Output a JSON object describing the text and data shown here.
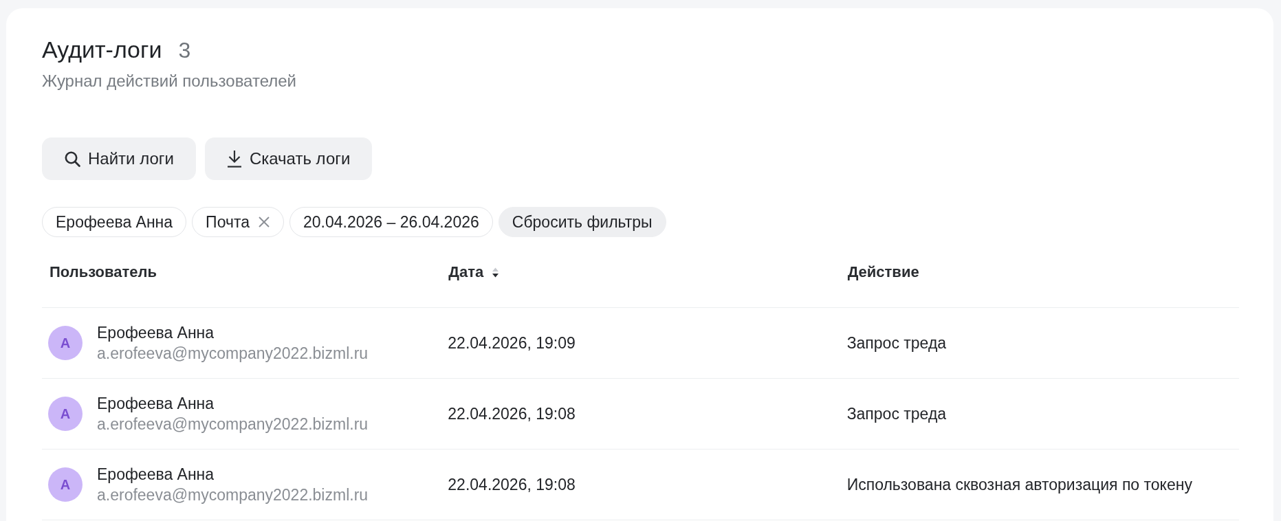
{
  "header": {
    "title": "Аудит-логи",
    "count": "3",
    "subtitle": "Журнал действий пользователей"
  },
  "actions": [
    {
      "kind": "search",
      "label": "Найти логи"
    },
    {
      "kind": "download",
      "label": "Скачать логи"
    }
  ],
  "filters": {
    "chips": [
      {
        "label": "Ерофеева Анна",
        "removable": false
      },
      {
        "label": "Почта",
        "removable": true
      },
      {
        "label": "20.04.2026 – 26.04.2026",
        "removable": false
      }
    ],
    "reset": "Сбросить фильтры"
  },
  "table": {
    "columns": [
      {
        "label": "Пользователь",
        "sorted": false
      },
      {
        "label": "Дата",
        "sorted": true,
        "descending": true
      },
      {
        "label": "Действие",
        "sorted": false
      }
    ],
    "rows": [
      {
        "avatar": "А",
        "name": "Ерофеева Анна",
        "email": "a.erofeeva@mycompany2022.bizml.ru",
        "date": "22.04.2026, 19:09",
        "action": "Запрос треда"
      },
      {
        "avatar": "А",
        "name": "Ерофеева Анна",
        "email": "a.erofeeva@mycompany2022.bizml.ru",
        "date": "22.04.2026, 19:08",
        "action": "Запрос треда"
      },
      {
        "avatar": "А",
        "name": "Ерофеева Анна",
        "email": "a.erofeeva@mycompany2022.bizml.ru",
        "date": "22.04.2026, 19:08",
        "action": "Использована сквозная авторизация по токену"
      }
    ]
  }
}
